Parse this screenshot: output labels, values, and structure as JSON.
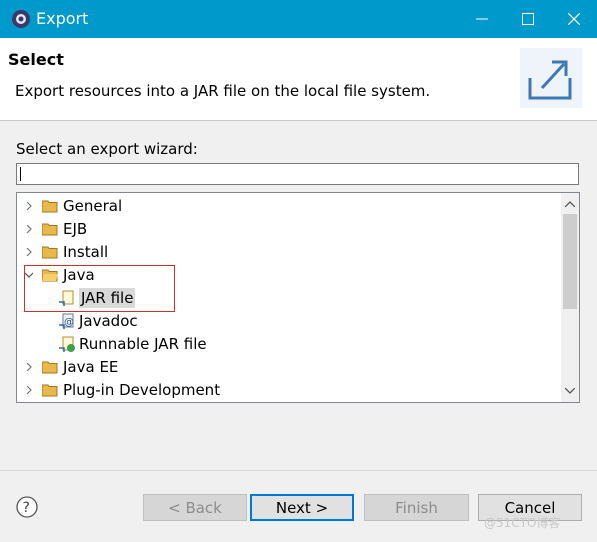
{
  "window": {
    "title": "Export",
    "icons": {
      "app": "gear-icon",
      "minimize": "minimize-icon",
      "maximize": "maximize-icon",
      "close": "close-icon"
    }
  },
  "header": {
    "title": "Select",
    "description": "Export resources into a JAR file on the local file system.",
    "banner_icon": "export-icon"
  },
  "wizard": {
    "label": "Select an export wizard:",
    "filter_value": "",
    "tree": [
      {
        "label": "General",
        "type": "folder",
        "expanded": false
      },
      {
        "label": "EJB",
        "type": "folder",
        "expanded": false
      },
      {
        "label": "Install",
        "type": "folder",
        "expanded": false
      },
      {
        "label": "Java",
        "type": "folder",
        "expanded": true,
        "children": [
          {
            "label": "JAR file",
            "selected": true,
            "icon": "jar-file-icon"
          },
          {
            "label": "Javadoc",
            "icon": "javadoc-icon"
          },
          {
            "label": "Runnable JAR file",
            "icon": "runnable-jar-icon"
          }
        ]
      },
      {
        "label": "Java EE",
        "type": "folder",
        "expanded": false
      },
      {
        "label": "Plug-in Development",
        "type": "folder",
        "expanded": false
      }
    ]
  },
  "buttons": {
    "back": "< Back",
    "next": "Next >",
    "finish": "Finish",
    "cancel": "Cancel"
  },
  "watermark": "@51CTO博客",
  "colors": {
    "titlebar": "#0099cc",
    "highlight_border": "#d0302c",
    "default_button_border": "#0078d7"
  }
}
